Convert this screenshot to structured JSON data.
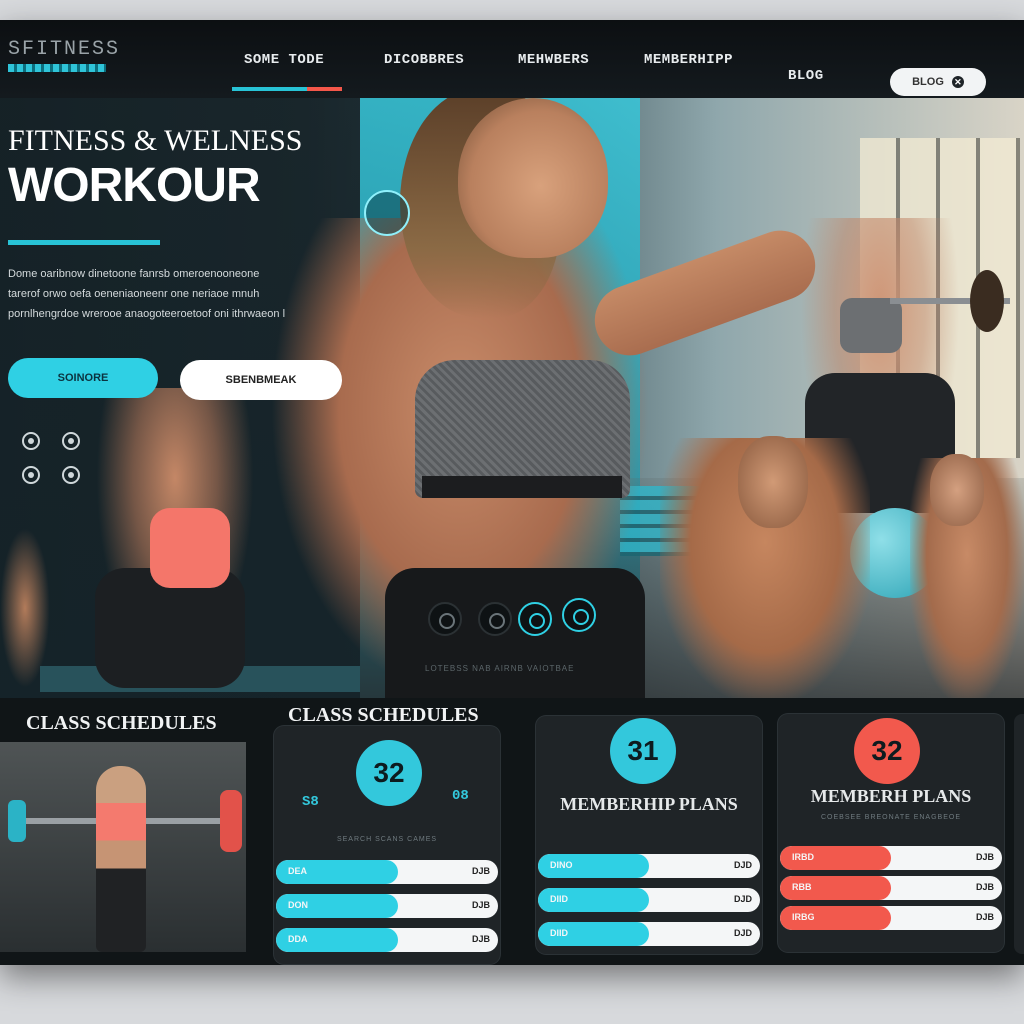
{
  "nav": {
    "logo": "SFITNESS",
    "links": [
      "SOME TODE",
      "DICOBBRES",
      "MEHWBERS",
      "MEMBERHIPP",
      "BLOG"
    ],
    "pill_label": "BLOG",
    "pill_icon": "close-icon"
  },
  "hero": {
    "title_line1": "FITNESS & WELNESS",
    "title_line2": "WORKOUR",
    "description": [
      "Dome oaribnow dinetoone fanrsb omeroenooneone",
      "tarerof orwo oefa oeneniaoneenr one neriaoe mnuh",
      "pornlhengrdoe wrerooe anaogoteeroetoof oni ithrwaeon l"
    ],
    "primary_button": "SOINORE",
    "secondary_button": "SBENBMEAK",
    "shorts_caption": "LOTEBSS  NAB  AIRNB  VAIOTBAE"
  },
  "schedule": {
    "title_left": "CLASS SCHEDULES",
    "title_center": "CLASS SCHEDULES",
    "card1": {
      "badge": "32",
      "left_tag": "S8",
      "right_tag": "08",
      "subtitle": "SEARCH  SCANS  CAMES",
      "rows": [
        {
          "label": "DEA",
          "value": "DJB",
          "fill": 0.55
        },
        {
          "label": "DON",
          "value": "DJB",
          "fill": 0.55
        },
        {
          "label": "DDA",
          "value": "DJB",
          "fill": 0.55
        }
      ]
    }
  },
  "plans": {
    "card2": {
      "badge": "31",
      "title": "MEMBERHIP PLANS",
      "rows": [
        {
          "label": "DINO",
          "value": "DJD",
          "fill": 0.5
        },
        {
          "label": "DIID",
          "value": "DJD",
          "fill": 0.5
        },
        {
          "label": "DIID",
          "value": "DJD",
          "fill": 0.5
        }
      ]
    },
    "card3": {
      "badge": "32",
      "title": "MEMBERH PLANS",
      "subtitle": "COEBSEE  BREONATE  ENAGBEOE",
      "rows": [
        {
          "label": "IRBD",
          "value": "DJB",
          "fill": 0.5
        },
        {
          "label": "RBB",
          "value": "DJB",
          "fill": 0.5
        },
        {
          "label": "IRBG",
          "value": "DJB",
          "fill": 0.5
        }
      ]
    }
  },
  "colors": {
    "accent_cyan": "#2fd0e4",
    "accent_red": "#f2594d",
    "background": "#0f1417"
  }
}
